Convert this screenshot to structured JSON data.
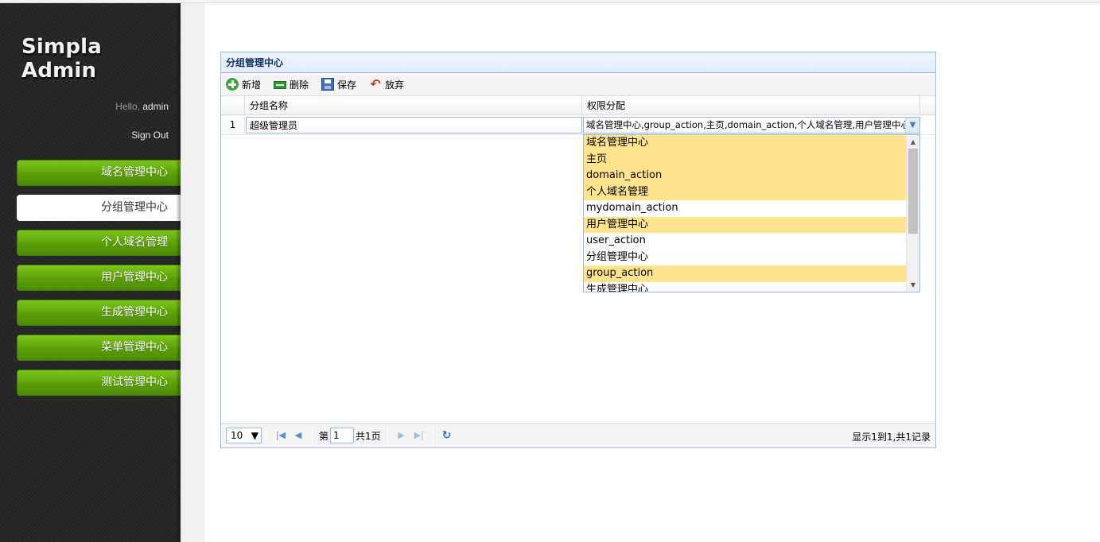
{
  "sidebar": {
    "brand": "Simpla Admin",
    "hello_prefix": "Hello,",
    "user": "admin",
    "sign_out": "Sign Out",
    "items": [
      {
        "label": "域名管理中心",
        "active": false
      },
      {
        "label": "分组管理中心",
        "active": true
      },
      {
        "label": "个人域名管理",
        "active": false
      },
      {
        "label": "用户管理中心",
        "active": false
      },
      {
        "label": "生成管理中心",
        "active": false
      },
      {
        "label": "菜单管理中心",
        "active": false
      },
      {
        "label": "测试管理中心",
        "active": false
      }
    ]
  },
  "panel": {
    "title": "分组管理中心",
    "toolbar": {
      "add": "新增",
      "delete": "删除",
      "save": "保存",
      "cancel": "放弃"
    },
    "columns": {
      "name": "分组名称",
      "permissions": "权限分配"
    },
    "rows": [
      {
        "num": "1",
        "name": "超级管理员",
        "permissions": "域名管理中心,group_action,主页,domain_action,个人域名管理,用户管理中心"
      }
    ],
    "dropdown": [
      {
        "label": "域名管理中心",
        "selected": true
      },
      {
        "label": "主页",
        "selected": true
      },
      {
        "label": "domain_action",
        "selected": true
      },
      {
        "label": "个人域名管理",
        "selected": true
      },
      {
        "label": "mydomain_action",
        "selected": false
      },
      {
        "label": "用户管理中心",
        "selected": true
      },
      {
        "label": "user_action",
        "selected": false
      },
      {
        "label": "分组管理中心",
        "selected": false
      },
      {
        "label": "group_action",
        "selected": true
      },
      {
        "label": "生成管理中心",
        "selected": false
      }
    ],
    "pager": {
      "page_size": "10",
      "page_prefix": "第",
      "page_value": "1",
      "page_total": "共1页",
      "info": "显示1到1,共1记录"
    }
  },
  "colors": {
    "nav_green": "#5a9e08",
    "panel_border": "#99bbe8",
    "selected_item": "#ffe48d"
  }
}
